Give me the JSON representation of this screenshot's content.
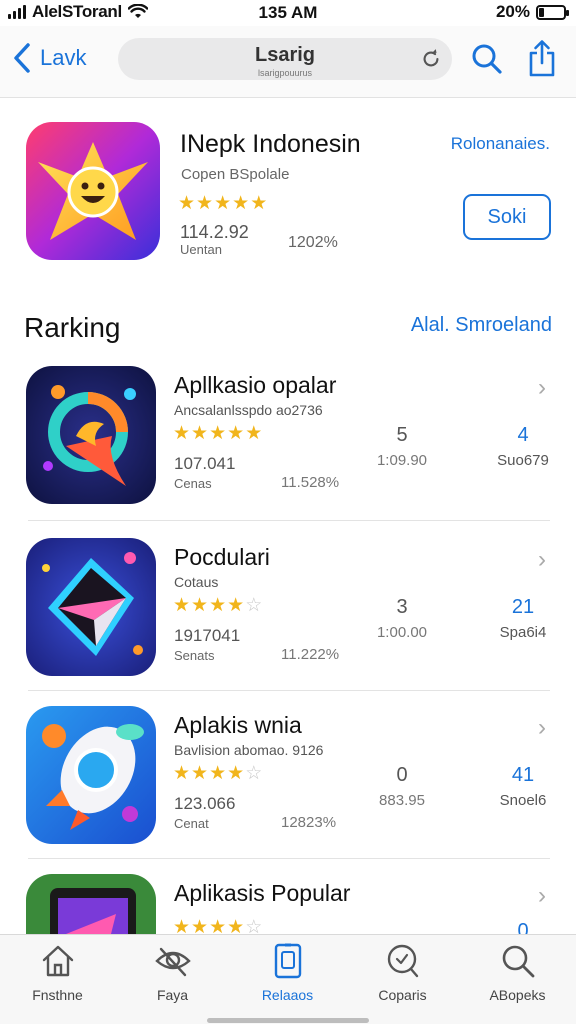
{
  "status_bar": {
    "carrier": "AlelSToranl",
    "time": "135 AM",
    "battery": "20%",
    "battery_level": 0.2
  },
  "nav": {
    "back_label": "Lavk",
    "search_title": "Lsarig",
    "search_subtitle": "lsarigpouurus"
  },
  "featured": {
    "title": "INepk Indonesin",
    "subtitle": "Copen BSpolale",
    "link": "Rolonanaies.",
    "rating": 4.5,
    "count": "114.2.92",
    "caption": "Uentan",
    "size": "1202%",
    "get_label": "Soki"
  },
  "section": {
    "title": "Rarking",
    "link": "Alal. Smroeland"
  },
  "apps": [
    {
      "title": "Apllkasio opalar",
      "subtitle": "Ancsalanlsspdo ao2736",
      "rating": 4.5,
      "count": "107.041",
      "caption": "Cenas",
      "size": "11.528%",
      "stat_a": "5",
      "stat_b": "1:09.90",
      "num": "4",
      "num_sub": "Suo679"
    },
    {
      "title": "Pocdulari",
      "subtitle": "Cotaus",
      "rating": 4,
      "count": "1917041",
      "caption": "Senats",
      "size": "11.222%",
      "stat_a": "3",
      "stat_b": "1:00.00",
      "num": "21",
      "num_sub": "Spa6i4"
    },
    {
      "title": "Aplakis wnia",
      "subtitle": "Bavlision abomao. 9126",
      "rating": 4,
      "count": "123.066",
      "caption": "Cenat",
      "size": "12823%",
      "stat_a": "0",
      "stat_b": "883.95",
      "num": "41",
      "num_sub": "Snoel6"
    },
    {
      "title": "Aplikasis Popular",
      "subtitle": "",
      "rating": 4,
      "count": "",
      "caption": "",
      "size": "",
      "stat_a": "",
      "stat_b": "",
      "num": "0",
      "num_sub": ""
    }
  ],
  "tabs": [
    {
      "label": "Fnsthne",
      "icon": "home-icon"
    },
    {
      "label": "Faya",
      "icon": "eye-slash-icon"
    },
    {
      "label": "Relaaos",
      "icon": "phone-icon",
      "active": true
    },
    {
      "label": "Coparis",
      "icon": "search-bubble-icon"
    },
    {
      "label": "ABopeks",
      "icon": "search-icon"
    }
  ],
  "colors": {
    "accent": "#1a73d9",
    "star": "#f1b51c"
  }
}
